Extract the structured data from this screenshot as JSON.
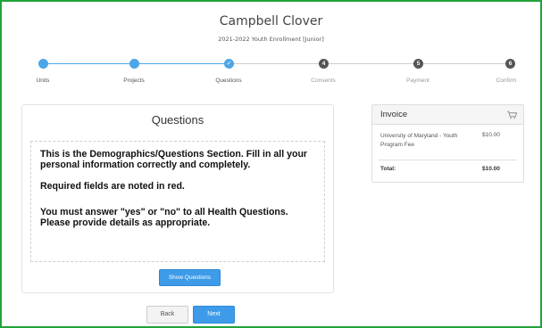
{
  "header": {
    "name": "Campbell Clover",
    "enrollment": "2021-2022 Youth Enrollment [Junior]"
  },
  "progress": {
    "steps": [
      {
        "label": "Units",
        "status": "done",
        "marker": ""
      },
      {
        "label": "Projects",
        "status": "done",
        "marker": ""
      },
      {
        "label": "Questions",
        "status": "current",
        "marker": "✓"
      },
      {
        "label": "Consents",
        "status": "todo",
        "marker": "4"
      },
      {
        "label": "Payment",
        "status": "todo",
        "marker": "5"
      },
      {
        "label": "Confirm",
        "status": "todo",
        "marker": "6"
      }
    ],
    "accent": "#4da6e8"
  },
  "questions": {
    "title": "Questions",
    "notice_p1": "This is the Demographics/Questions Section.  Fill in all your personal information correctly and completely.",
    "notice_p2": "Required fields are noted in red.",
    "notice_p3": "You must answer \"yes\" or \"no\" to all Health Questions. Please provide details as appropriate.",
    "show_button": "Show Questions"
  },
  "nav": {
    "back": "Back",
    "next": "Next"
  },
  "invoice": {
    "title": "Invoice",
    "icon": "cart-icon",
    "item_label": "University of Maryland - Youth Program Fee",
    "item_amount": "$10.00",
    "total_label": "Total:",
    "total_amount": "$10.00"
  },
  "colors": {
    "frame": "#22a33a",
    "primary": "#3d9be9"
  }
}
